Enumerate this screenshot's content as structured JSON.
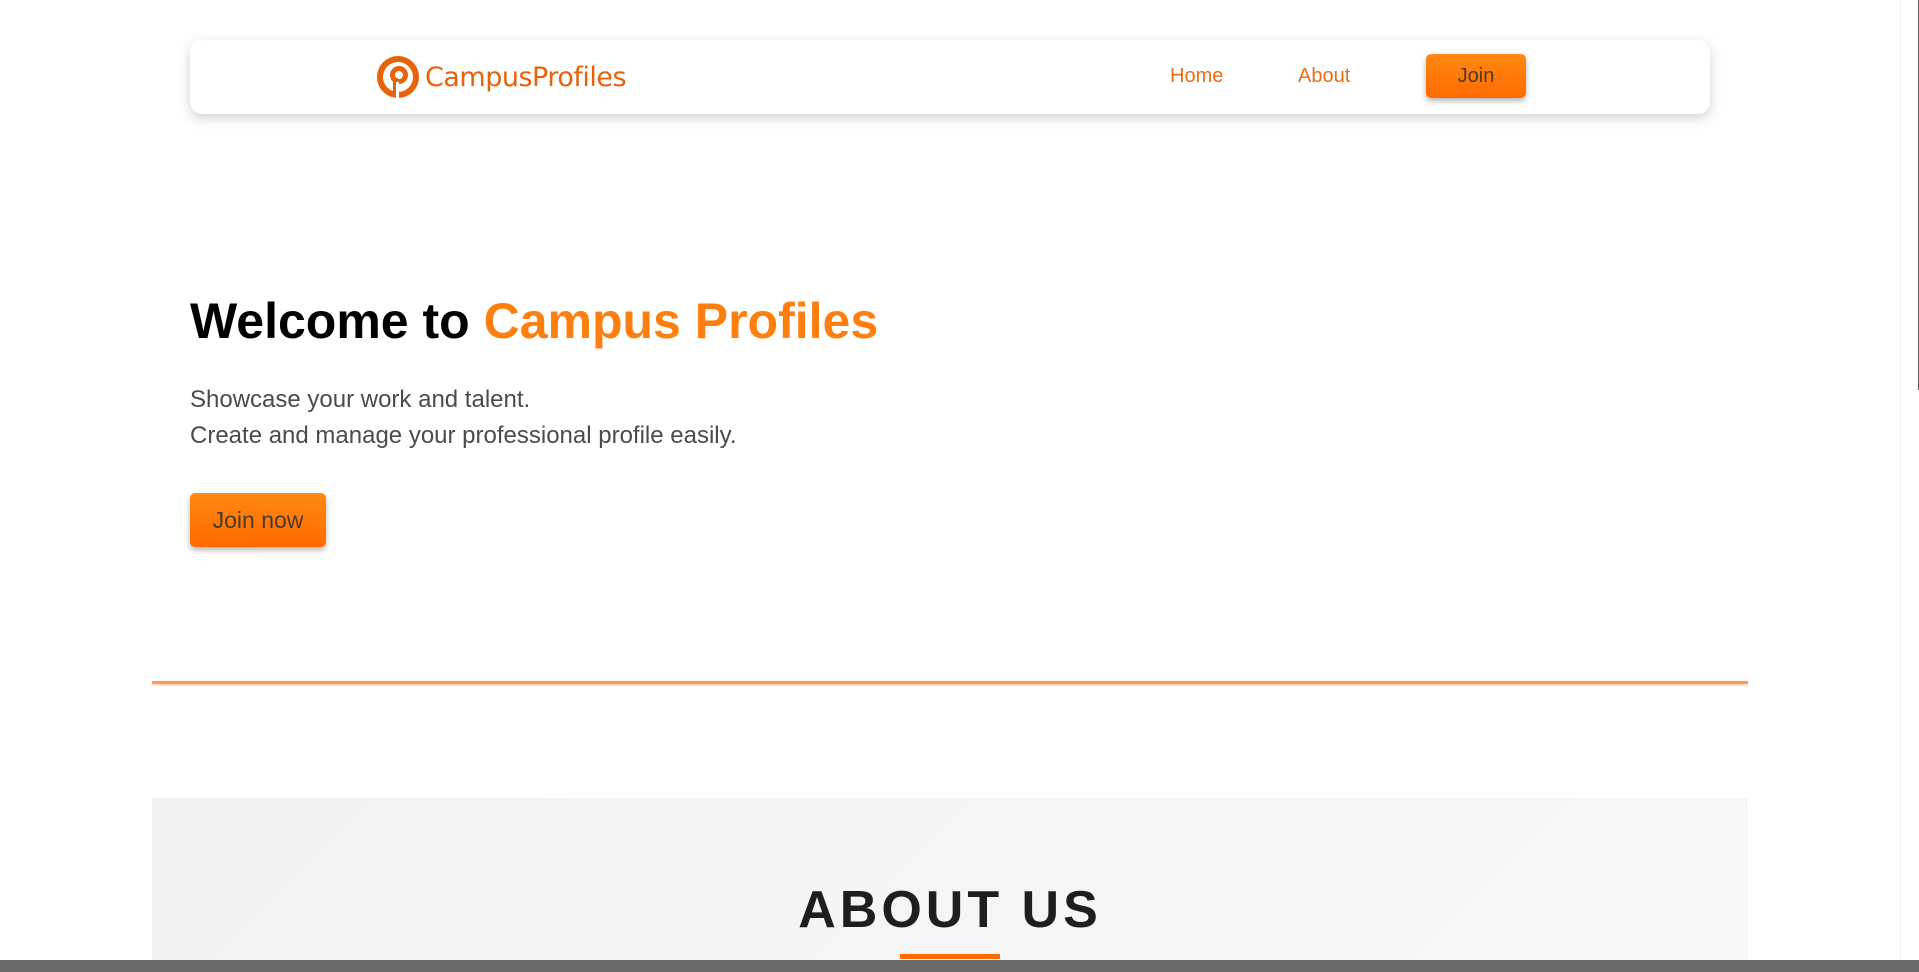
{
  "navbar": {
    "logo_text": "CampusProfiles",
    "links": [
      {
        "label": "Home"
      },
      {
        "label": "About"
      }
    ],
    "join_label": "Join"
  },
  "hero": {
    "title_prefix": "Welcome to",
    "title_accent": "Campus Profiles",
    "line1": "Showcase your work and talent.",
    "line2": "Create and manage your professional profile easily.",
    "cta_label": "Join now"
  },
  "about": {
    "title": "ABOUT US"
  },
  "colors": {
    "accent": "#ff7f0e",
    "button": "#ff6a00",
    "link": "#f06a14"
  }
}
